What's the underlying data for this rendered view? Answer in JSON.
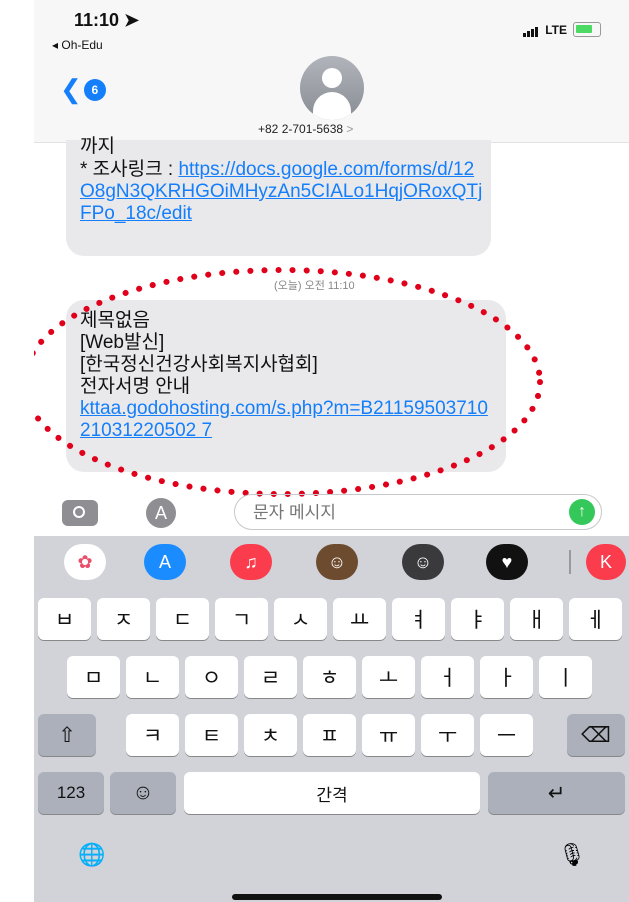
{
  "status": {
    "time": "11:10",
    "back_app": "◂ Oh-Edu",
    "network": "LTE"
  },
  "header": {
    "unread_count": "6",
    "phone_number": "+82 2-701-5638",
    "chevron": ">"
  },
  "messages": {
    "m1": {
      "cut_line": "까지",
      "label": "* 조사링크 : ",
      "link": "https://docs.google.com/forms/d/12O8gN3QKRHGOiMHyzAn5CIALo1HqjORoxQTjFPo_18c/edit"
    },
    "timestamp": "(오늘) 오전 11:10",
    "m2": {
      "line1": "제목없음",
      "line2": "[Web발신]",
      "line3": "[한국정신건강사회복지사협회]",
      "line4": "전자서명 안내",
      "link": "kttaa.godohosting.com/s.php?m=B2115950371021031220502 7"
    }
  },
  "compose": {
    "placeholder": "문자 메시지",
    "send_icon": "arrow-up-icon"
  },
  "keyboard": {
    "row1": [
      "ㅂ",
      "ㅈ",
      "ㄷ",
      "ㄱ",
      "ㅅ",
      "ㅛ",
      "ㅕ",
      "ㅑ",
      "ㅐ",
      "ㅔ"
    ],
    "row2": [
      "ㅁ",
      "ㄴ",
      "ㅇ",
      "ㄹ",
      "ㅎ",
      "ㅗ",
      "ㅓ",
      "ㅏ",
      "ㅣ"
    ],
    "row3": [
      "ㅋ",
      "ㅌ",
      "ㅊ",
      "ㅍ",
      "ㅠ",
      "ㅜ",
      "ㅡ"
    ],
    "numbers_label": "123",
    "space_label": "간격",
    "shift_icon": "⇧",
    "delete_icon": "⌫",
    "return_icon": "↵",
    "emoji_icon": "☺",
    "globe_icon": "🌐",
    "mic_icon": "🎙"
  },
  "colors": {
    "accent": "#147efb",
    "bubble": "#e9e9eb",
    "annotation": "#e0001b",
    "send": "#34c759"
  }
}
